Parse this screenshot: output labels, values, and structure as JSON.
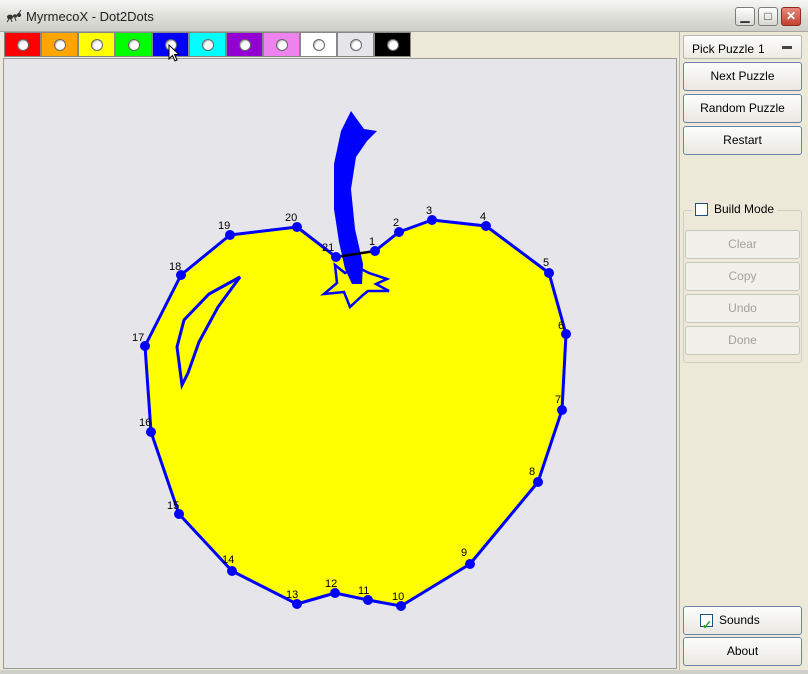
{
  "window": {
    "title": "MyrmecoX - Dot2Dots",
    "min_glyph": "▁",
    "max_glyph": "□",
    "close_glyph": "✕"
  },
  "palette": [
    {
      "color": "#ff0000"
    },
    {
      "color": "#ffa500"
    },
    {
      "color": "#ffff00"
    },
    {
      "color": "#00ff00"
    },
    {
      "color": "#0000ff",
      "selected": true
    },
    {
      "color": "#00ffff"
    },
    {
      "color": "#9400d3"
    },
    {
      "color": "#ee82ee"
    },
    {
      "color": "#ffffff"
    },
    {
      "color": "#e6e5ea"
    },
    {
      "color": "#000000"
    }
  ],
  "puzzle": {
    "fill_color": "#ffff00",
    "line_color": "#0000ff",
    "dots": [
      {
        "n": "1"
      },
      {
        "n": "2"
      },
      {
        "n": "3"
      },
      {
        "n": "4"
      },
      {
        "n": "5"
      },
      {
        "n": "6"
      },
      {
        "n": "7"
      },
      {
        "n": "8"
      },
      {
        "n": "9"
      },
      {
        "n": "10"
      },
      {
        "n": "11"
      },
      {
        "n": "12"
      },
      {
        "n": "13"
      },
      {
        "n": "14"
      },
      {
        "n": "15"
      },
      {
        "n": "16"
      },
      {
        "n": "17"
      },
      {
        "n": "18"
      },
      {
        "n": "19"
      },
      {
        "n": "20"
      },
      {
        "n": "21"
      }
    ]
  },
  "sidebar": {
    "pick_label": "Pick Puzzle",
    "pick_value": "1",
    "next_label": "Next Puzzle",
    "random_label": "Random Puzzle",
    "restart_label": "Restart",
    "build_mode_label": "Build Mode",
    "clear_label": "Clear",
    "copy_label": "Copy",
    "undo_label": "Undo",
    "done_label": "Done",
    "sounds_label": "Sounds",
    "about_label": "About"
  }
}
